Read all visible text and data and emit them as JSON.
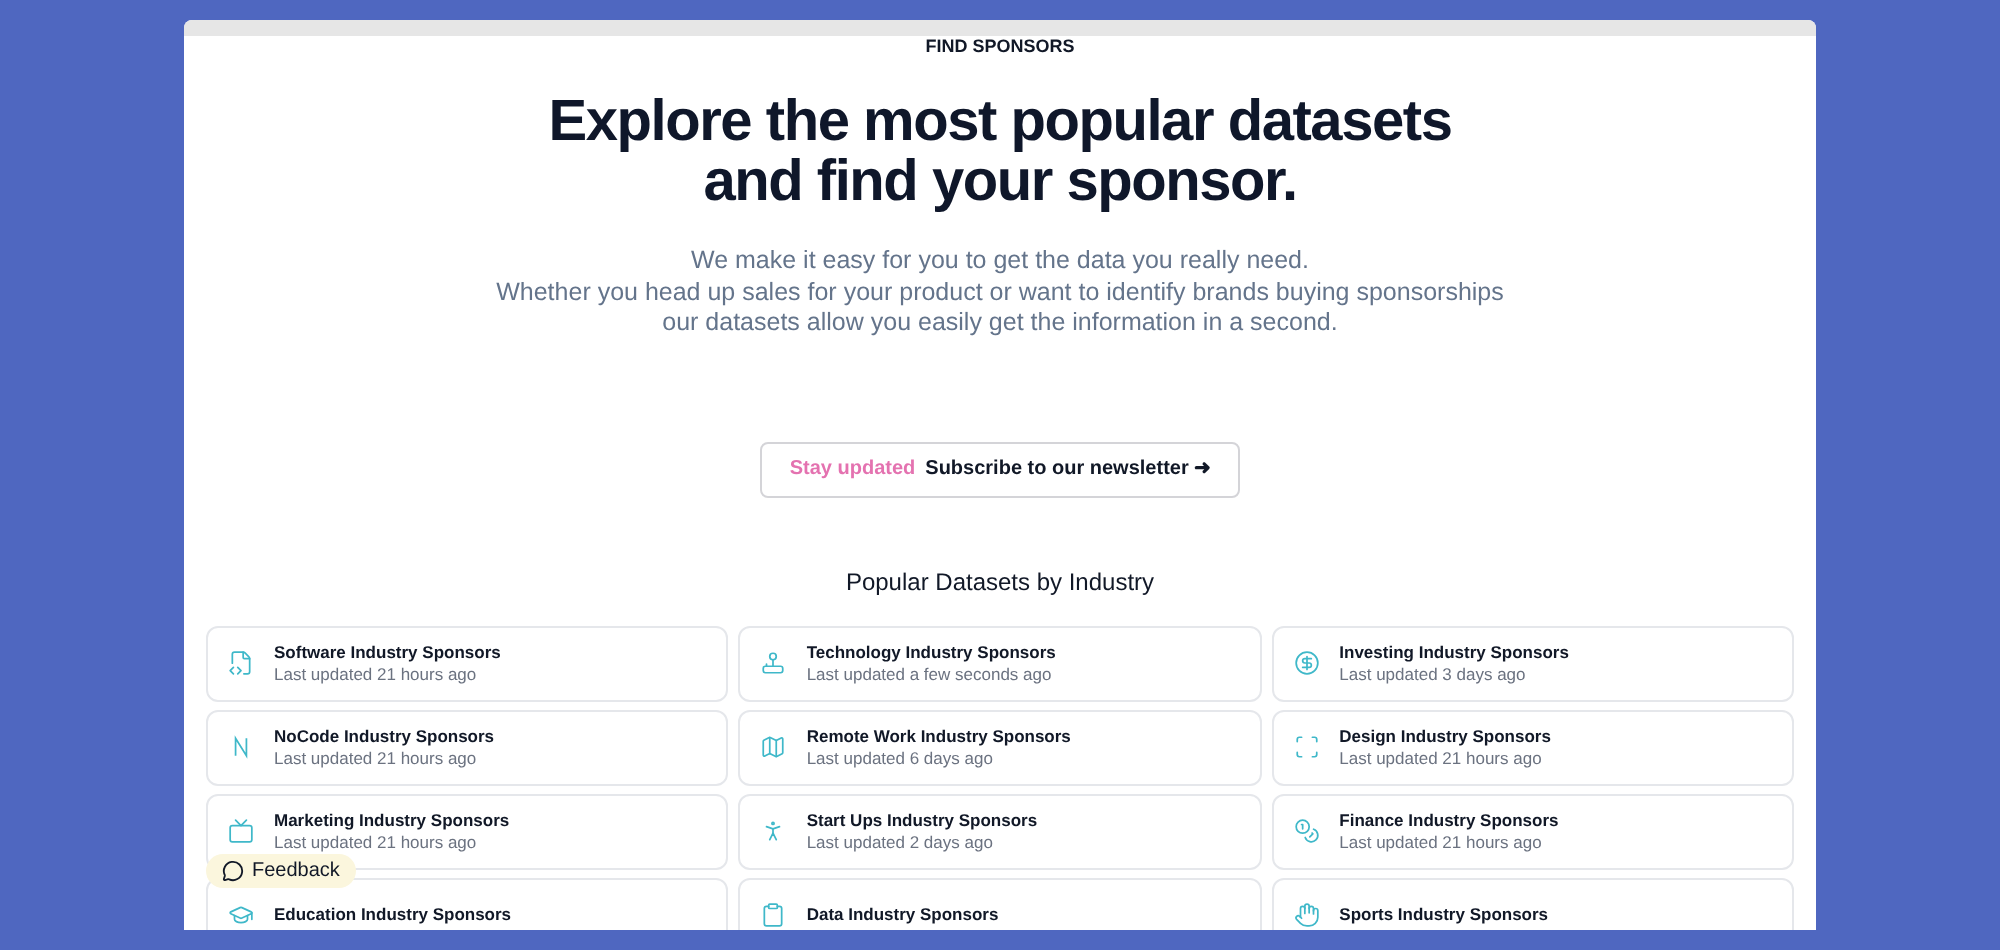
{
  "eyebrow": "FIND SPONSORS",
  "title": [
    "Explore the most popular datasets",
    "and find your sponsor."
  ],
  "intro": [
    "We make it easy for you to get the data you really need.",
    "Whether you head up sales for your product or want to identify brands buying sponsorships",
    "our datasets allow you easily get the information in a second."
  ],
  "newsletter": {
    "tag": "Stay updated",
    "label": "Subscribe to our newsletter ➜"
  },
  "section_title": "Popular Datasets by Industry",
  "datasets": [
    {
      "name": "Software Industry Sponsors",
      "updated": "Last updated 21 hours ago"
    },
    {
      "name": "Technology Industry Sponsors",
      "updated": "Last updated a few seconds ago"
    },
    {
      "name": "Investing Industry Sponsors",
      "updated": "Last updated 3 days ago"
    },
    {
      "name": "NoCode Industry Sponsors",
      "updated": "Last updated 21 hours ago"
    },
    {
      "name": "Remote Work Industry Sponsors",
      "updated": "Last updated 6 days ago"
    },
    {
      "name": "Design Industry Sponsors",
      "updated": "Last updated 21 hours ago"
    },
    {
      "name": "Marketing Industry Sponsors",
      "updated": "Last updated 21 hours ago"
    },
    {
      "name": "Start Ups Industry Sponsors",
      "updated": "Last updated 2 days ago"
    },
    {
      "name": "Finance Industry Sponsors",
      "updated": "Last updated 21 hours ago"
    },
    {
      "name": "Education Industry Sponsors"
    },
    {
      "name": "Data Industry Sponsors"
    },
    {
      "name": "Sports Industry Sponsors"
    }
  ],
  "feedback": {
    "label": "Feedback"
  }
}
